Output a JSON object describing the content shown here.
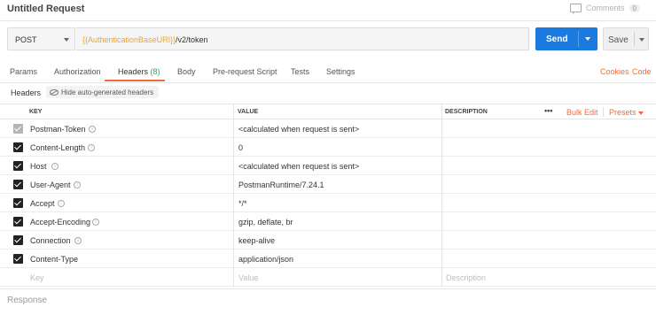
{
  "title": "Untitled Request",
  "comments": {
    "label": "Comments",
    "count": "0"
  },
  "request": {
    "method": "POST",
    "url_variable": "{{AuthenticationBaseURI}}",
    "url_path": "/v2/token",
    "send_label": "Send",
    "save_label": "Save"
  },
  "tabs": [
    {
      "label": "Params"
    },
    {
      "label": "Authorization"
    },
    {
      "label": "Headers",
      "badge": "(8)"
    },
    {
      "label": "Body"
    },
    {
      "label": "Pre-request Script"
    },
    {
      "label": "Tests"
    },
    {
      "label": "Settings"
    }
  ],
  "links": {
    "cookies": "Cookies",
    "code": "Code"
  },
  "headers_toolbar": {
    "label": "Headers",
    "hide_button": "Hide auto-generated headers"
  },
  "table": {
    "columns": {
      "key": "KEY",
      "value": "VALUE",
      "description": "DESCRIPTION"
    },
    "actions": {
      "more": "•••",
      "bulk_edit": "Bulk Edit",
      "presets": "Presets"
    },
    "rows": [
      {
        "key": "Postman-Token",
        "value": "<calculated when request is sent>",
        "checked": "disabled"
      },
      {
        "key": "Content-Length",
        "value": "0",
        "checked": "true"
      },
      {
        "key": "Host",
        "value": "<calculated when request is sent>",
        "checked": "true"
      },
      {
        "key": "User-Agent",
        "value": "PostmanRuntime/7.24.1",
        "checked": "true"
      },
      {
        "key": "Accept",
        "value": "*/*",
        "checked": "true"
      },
      {
        "key": "Accept-Encoding",
        "value": "gzip, deflate, br",
        "checked": "true"
      },
      {
        "key": "Connection",
        "value": "keep-alive",
        "checked": "true"
      },
      {
        "key": "Content-Type",
        "value": "application/json",
        "checked": "true"
      }
    ],
    "placeholders": {
      "key": "Key",
      "value": "Value",
      "description": "Description"
    }
  },
  "response_label": "Response",
  "colors": {
    "accent": "#f26b3a",
    "send": "#1a7ae0",
    "badge": "#3e9e5b",
    "url_variable": "#e8a33c"
  }
}
